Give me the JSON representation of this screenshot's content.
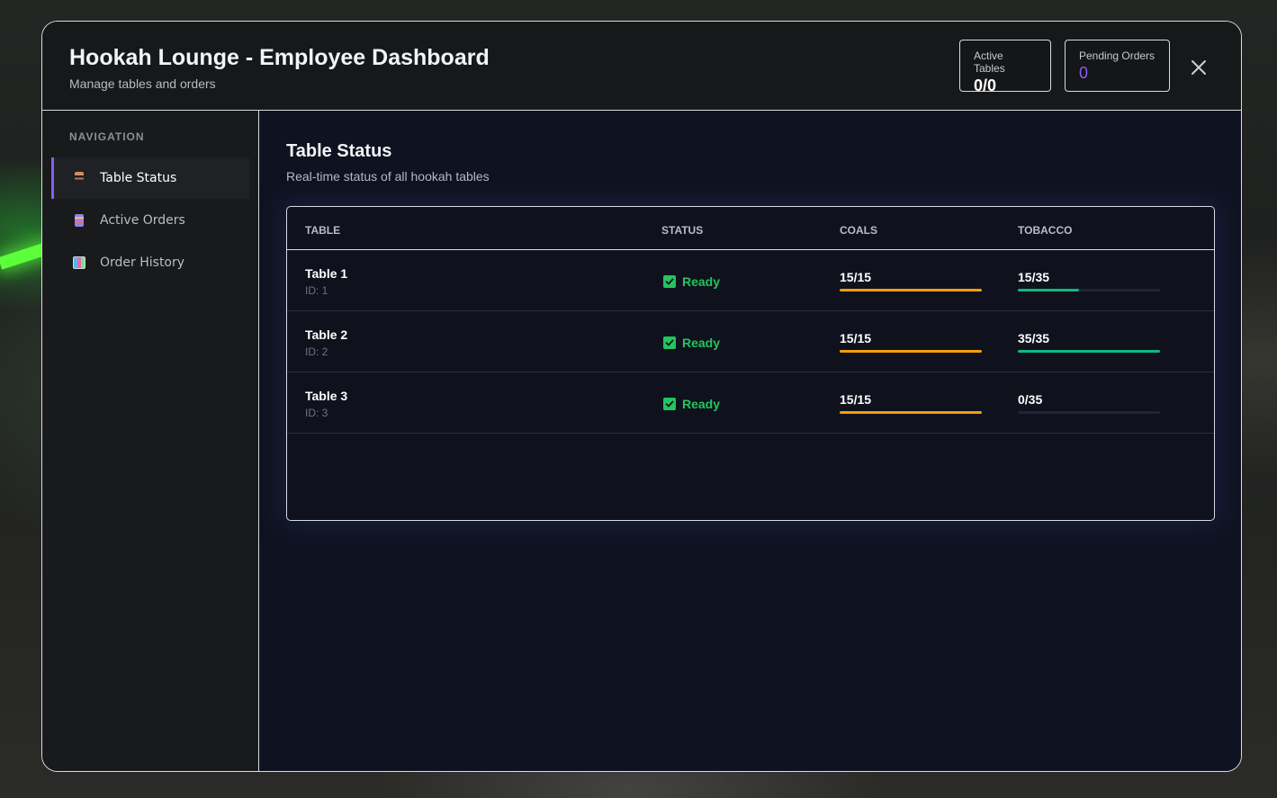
{
  "header": {
    "title": "Hookah Lounge - Employee Dashboard",
    "subtitle": "Manage tables and orders",
    "stats": {
      "active_tables_label": "Active Tables",
      "active_tables_value": "0/0",
      "pending_orders_label": "Pending Orders",
      "pending_orders_value": "0"
    }
  },
  "sidebar": {
    "heading": "NAVIGATION",
    "items": [
      {
        "label": "Table Status",
        "icon": "table-icon",
        "active": true
      },
      {
        "label": "Active Orders",
        "icon": "orders-icon",
        "active": false
      },
      {
        "label": "Order History",
        "icon": "chart-icon",
        "active": false
      }
    ]
  },
  "main": {
    "title": "Table Status",
    "subtitle": "Real-time status of all hookah tables",
    "columns": [
      "TABLE",
      "STATUS",
      "COALS",
      "TOBACCO"
    ],
    "rows": [
      {
        "name": "Table 1",
        "id": "ID: 1",
        "status": "Ready",
        "coals": "15/15",
        "coals_fraction": 1.0,
        "tobacco": "15/35",
        "tobacco_fraction": 0.4286
      },
      {
        "name": "Table 2",
        "id": "ID: 2",
        "status": "Ready",
        "coals": "15/15",
        "coals_fraction": 1.0,
        "tobacco": "35/35",
        "tobacco_fraction": 1.0
      },
      {
        "name": "Table 3",
        "id": "ID: 3",
        "status": "Ready",
        "coals": "15/15",
        "coals_fraction": 1.0,
        "tobacco": "0/35",
        "tobacco_fraction": 0.0
      }
    ]
  },
  "colors": {
    "accent": "#8a5cf6",
    "ready": "#22c55e",
    "coals_bar": "#f59e0b",
    "tobacco_bar": "#10b981"
  }
}
